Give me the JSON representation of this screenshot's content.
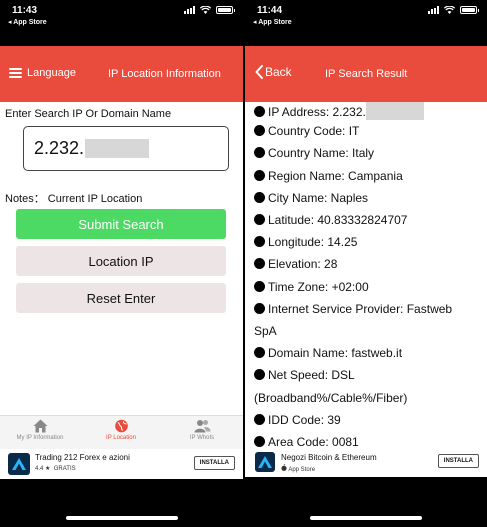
{
  "left_screen": {
    "status_bar": {
      "time": "11:43",
      "back_app": "◂ App Store"
    },
    "navbar": {
      "menu_label": "Language",
      "title": "IP Location Information"
    },
    "search": {
      "label": "Enter Search IP Or Domain Name",
      "value": "2.232."
    },
    "notes": "Notes：  Current IP Location",
    "buttons": {
      "submit": "Submit Search",
      "location": "Location IP",
      "reset": "Reset Enter"
    },
    "tabs": [
      {
        "label": "My IP Information",
        "icon": "home-icon"
      },
      {
        "label": "IP Location",
        "icon": "globe-icon"
      },
      {
        "label": "IP WhoIs",
        "icon": "users-icon"
      }
    ],
    "active_tab": "IP Location",
    "ad": {
      "title": "Trading 212 Forex e azioni",
      "rating": "4.4 ★",
      "price": "GRATIS",
      "button": "INSTALLA"
    }
  },
  "right_screen": {
    "status_bar": {
      "time": "11:44",
      "back_app": "◂ App Store"
    },
    "navbar": {
      "back_label": "Back",
      "title": "IP Search Result"
    },
    "results": [
      "IP Address: 2.232.",
      "Country Code: IT",
      "Country Name: Italy",
      "Region Name: Campania",
      "City Name: Naples",
      "Latitude: 40.83332824707",
      "Longitude: 14.25",
      "Elevation: 28",
      "Time Zone: +02:00",
      "Internet Service Provider: Fastweb",
      "SpA",
      "Domain Name: fastweb.it",
      "Net Speed: DSL",
      "(Broadband%/Cable%/Fiber)",
      "IDD Code: 39",
      "Area Code: 0081"
    ],
    "ad": {
      "title": "Negozi Bitcoin & Ethereum",
      "store": "App Store",
      "button": "INSTALLA"
    }
  },
  "colors": {
    "accent": "#e94b3c",
    "submit_green": "#4cd964",
    "button_gray": "#ede5e5",
    "redaction_gray": "#d7d7d7"
  }
}
